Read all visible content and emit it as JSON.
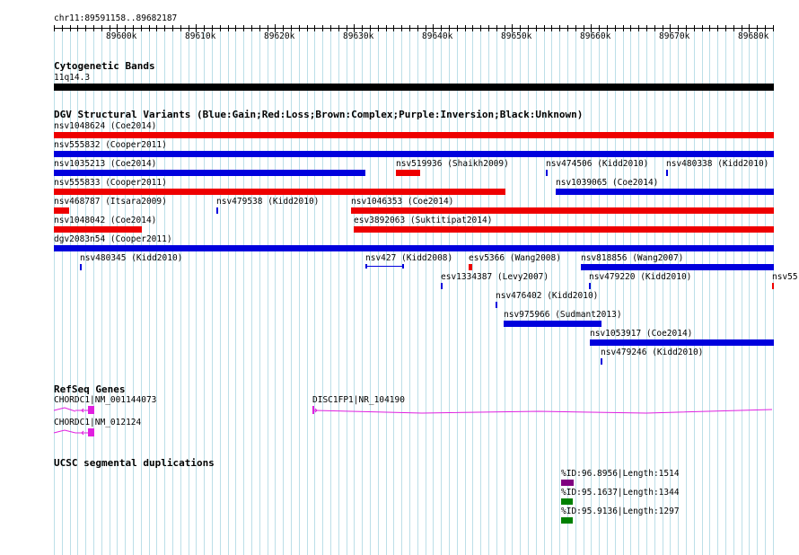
{
  "ruler": {
    "position": "chr11:89591158..89682187",
    "ticks": [
      "89600k",
      "89610k",
      "89620k",
      "89630k",
      "89640k",
      "89650k",
      "89660k",
      "89670k",
      "89680k"
    ]
  },
  "cytoband": {
    "title": "Cytogenetic Bands",
    "band": "11q14.3"
  },
  "dgv": {
    "title": "DGV Structural Variants (Blue:Gain;Red:Loss;Brown:Complex;Purple:Inversion;Black:Unknown)",
    "colors": {
      "gain": "#0000dd",
      "loss": "#ee0000",
      "complex": "#8b4513",
      "inversion": "#800080",
      "unknown": "#000000"
    },
    "features": [
      {
        "label": "nsv1048624 (Coe2014)",
        "type": "loss"
      },
      {
        "label": "nsv555832 (Cooper2011)",
        "type": "gain"
      },
      {
        "label": "nsv1035213 (Coe2014)",
        "type": "gain"
      },
      {
        "label": "nsv519936 (Shaikh2009)",
        "type": "loss"
      },
      {
        "label": "nsv474506 (Kidd2010)",
        "type": "gain"
      },
      {
        "label": "nsv480338 (Kidd2010)",
        "type": "gain"
      },
      {
        "label": "nsv555833 (Cooper2011)",
        "type": "loss"
      },
      {
        "label": "nsv1039065 (Coe2014)",
        "type": "gain"
      },
      {
        "label": "nsv468787 (Itsara2009)",
        "type": "loss"
      },
      {
        "label": "nsv479538 (Kidd2010)",
        "type": "gain"
      },
      {
        "label": "nsv1046353 (Coe2014)",
        "type": "loss"
      },
      {
        "label": "nsv1048042 (Coe2014)",
        "type": "loss"
      },
      {
        "label": "esv3892063 (Suktitipat2014)",
        "type": "loss"
      },
      {
        "label": "dgv2083n54 (Cooper2011)",
        "type": "gain"
      },
      {
        "label": "nsv480345 (Kidd2010)",
        "type": "gain"
      },
      {
        "label": "nsv427 (Kidd2008)",
        "type": "gain"
      },
      {
        "label": "esv5366 (Wang2008)",
        "type": "loss"
      },
      {
        "label": "nsv818856 (Wang2007)",
        "type": "gain"
      },
      {
        "label": "esv1334387 (Levy2007)",
        "type": "gain"
      },
      {
        "label": "nsv479220 (Kidd2010)",
        "type": "gain"
      },
      {
        "label": "nsv55",
        "type": "loss"
      },
      {
        "label": "nsv476402 (Kidd2010)",
        "type": "gain"
      },
      {
        "label": "nsv975966 (Sudmant2013)",
        "type": "gain"
      },
      {
        "label": "nsv1053917 (Coe2014)",
        "type": "gain"
      },
      {
        "label": "nsv479246 (Kidd2010)",
        "type": "gain"
      }
    ]
  },
  "refseq": {
    "title": "RefSeq Genes",
    "color": "#e020e0",
    "genes": [
      {
        "label": "CHORDC1|NM_001144073"
      },
      {
        "label": "DISC1FP1|NR_104190"
      },
      {
        "label": "CHORDC1|NM_012124"
      }
    ]
  },
  "segdups": {
    "title": "UCSC segmental duplications",
    "items": [
      {
        "label": "%ID:96.8956|Length:1514",
        "color": "#800080"
      },
      {
        "label": "%ID:95.1637|Length:1344",
        "color": "#008000"
      },
      {
        "label": "%ID:95.9136|Length:1297",
        "color": "#008000"
      }
    ]
  }
}
